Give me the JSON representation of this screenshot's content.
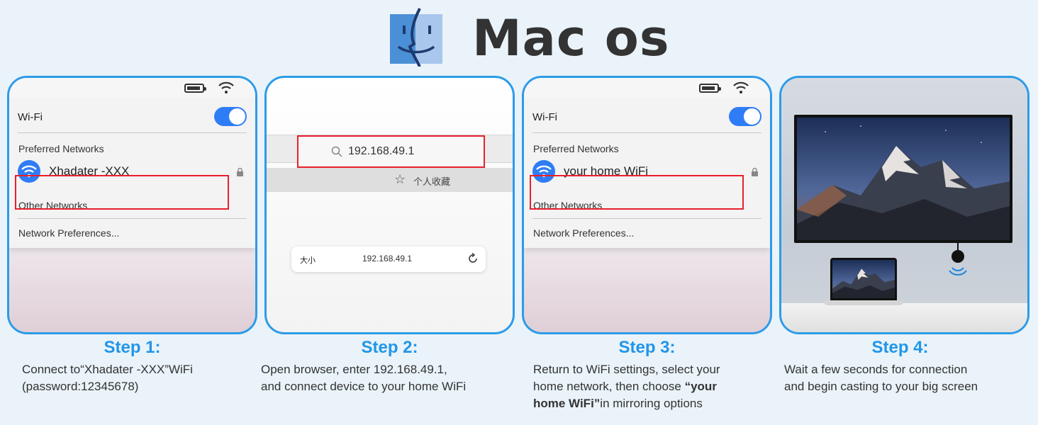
{
  "header": {
    "title": "Mac os",
    "logo_icon": "finder-face-icon"
  },
  "colors": {
    "accent": "#2196e8",
    "panel_border": "#2d9be8",
    "highlight_red": "#e8202a",
    "toggle_blue": "#2f7df6",
    "background": "#e9f3f9"
  },
  "panels": {
    "step1": {
      "wifi_label": "Wi-Fi",
      "preferred_label": "Preferred Networks",
      "network_name": "Xhadater -XXX",
      "other_label": "Other Networks",
      "prefs_label": "Network Preferences..."
    },
    "step2": {
      "address": "192.168.49.1",
      "bookmark_label": "个人收藏",
      "pill_size": "大小",
      "pill_url": "192.168.49.1"
    },
    "step3": {
      "wifi_label": "Wi-Fi",
      "preferred_label": "Preferred Networks",
      "network_name": "your home WiFi",
      "other_label": "Other Networks",
      "prefs_label": "Network Preferences..."
    }
  },
  "steps": [
    {
      "title": "Step 1:",
      "desc_1": "Connect to“Xhadater -XXX”WiFi",
      "desc_2": "(password:12345678)"
    },
    {
      "title": "Step 2:",
      "desc_1": "Open browser, enter 192.168.49.1,",
      "desc_2": "and connect device to your home WiFi"
    },
    {
      "title": "Step 3:",
      "desc_1": "Return to WiFi settings, select your",
      "desc_2a": "home network, then choose",
      "desc_2b": "“your",
      "desc_3a": "home WiFi”",
      "desc_3b": "in mirroring options"
    },
    {
      "title": "Step 4:",
      "desc_1": "Wait a few seconds for connection",
      "desc_2": "and begin casting to your big screen"
    }
  ]
}
